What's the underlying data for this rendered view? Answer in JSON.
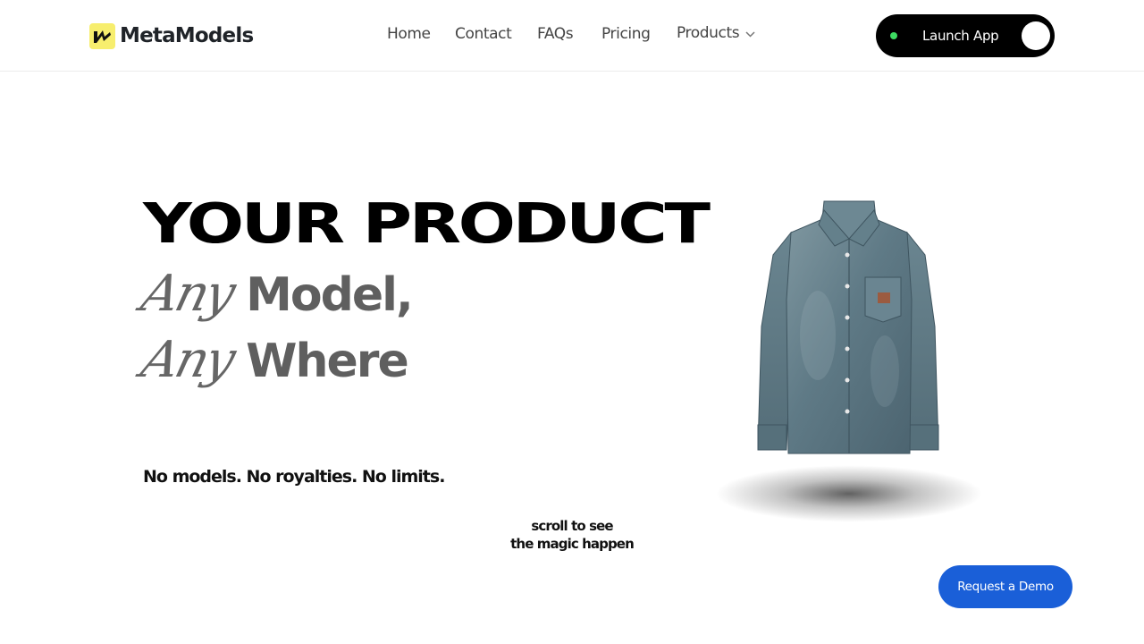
{
  "brand": {
    "name": "MetaModels",
    "accent": "#f7ee6e"
  },
  "nav": {
    "items": [
      {
        "label": "Home"
      },
      {
        "label": "Contact"
      },
      {
        "label": "FAQs"
      },
      {
        "label": "Pricing"
      },
      {
        "label": "Products"
      }
    ],
    "products_icon": "chevron-down-icon"
  },
  "launch": {
    "label": "Launch App",
    "status_color": "#3ddc62"
  },
  "hero": {
    "headline": "YOUR PRODUCT",
    "line1_script": "Any",
    "line1_text": "Model,",
    "line2_script": "Any",
    "line2_text": "Where",
    "tagline": "No models. No royalties. No limits.",
    "scroll_line1": "scroll to see",
    "scroll_line2": "the magic happen"
  },
  "demo": {
    "label": "Request a Demo",
    "color": "#1a5fd8"
  }
}
